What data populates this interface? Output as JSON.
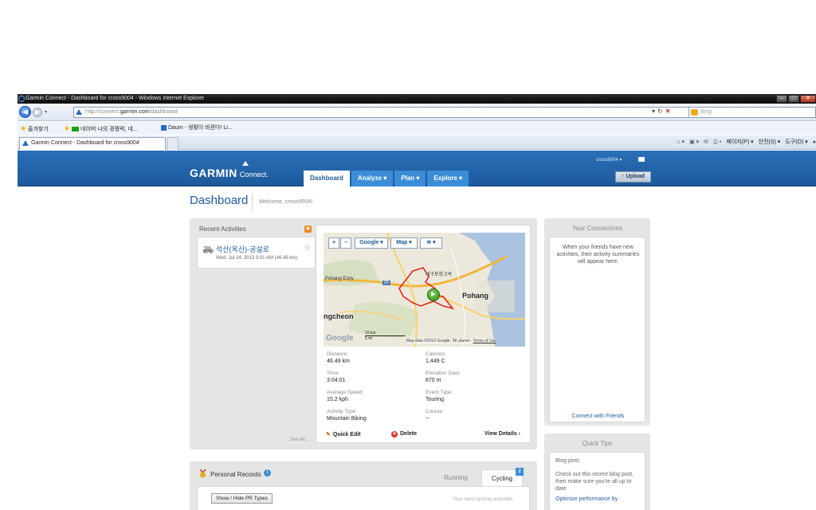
{
  "browser": {
    "title": "Garmin Connect - Dashboard for cross9004 - Windows Internet Explorer",
    "url_prefix": "http://connect.",
    "url_domain": "garmin.com",
    "url_path": "/dashboard",
    "search_placeholder": "Bing",
    "favorites": [
      "즐겨찾기",
      "네이버 나의 경쟁력, 네...",
      "Daum - 생활이 바뀐다! Li..."
    ],
    "tab_title": "Garmin Connect - Dashboard for cross9004",
    "commands": [
      "페이지(P) ▾",
      "안전(S) ▾",
      "도구(O) ▾"
    ]
  },
  "header": {
    "logo": "GARMIN",
    "logo_sub": "Connect.",
    "nav": [
      "Dashboard",
      "Analyze ▾",
      "Plan ▾",
      "Explore ▾"
    ],
    "user": "cross9004 ▾",
    "upload": "↑ Upload"
  },
  "page": {
    "title": "Dashboard",
    "welcome": "Welcome, cross9004!"
  },
  "recent": {
    "heading": "Recent Activities",
    "activity_name": "석산(옥산)-공설로",
    "activity_date": "Wed, Jul 24, 2013 9:01 AM (46.49 km)",
    "see_all": "See All...",
    "map": {
      "zoom_in": "+",
      "zoom_out": "−",
      "provider": "Google ▾",
      "type": "Map ▾",
      "layers": "≋ ▾",
      "labels": [
        "Pohang",
        "ngcheon",
        "-Pohang Expy",
        "대구포항고속"
      ],
      "shield": "20",
      "scale_km": "10 km",
      "scale_mi": "5 mi",
      "attribution_pre": "Map data ©2013 Google, SK planet -",
      "attribution_link": "Terms of Use",
      "watermark": "Google"
    },
    "stats": [
      {
        "label": "Distance:",
        "value": "46.49 km"
      },
      {
        "label": "Calories:",
        "value": "1,449 C"
      },
      {
        "label": "Time:",
        "value": "3:04:01"
      },
      {
        "label": "Elevation Gain:",
        "value": "870 m"
      },
      {
        "label": "Average Speed",
        "value": "15.2 kph"
      },
      {
        "label": "Event Type:",
        "value": "Touring"
      },
      {
        "label": "Activity Type:",
        "value": "Mountain Biking"
      },
      {
        "label": "Course:",
        "value": "--"
      }
    ],
    "actions": {
      "edit": "Quick Edit",
      "delete": "Delete",
      "details": "View Details ›"
    }
  },
  "connections": {
    "heading": "Your Connections",
    "message": "When your friends have new activities, their activity summaries will appear here.",
    "link": "Connect with Friends"
  },
  "tips": {
    "heading": "Quick Tips",
    "line1": "Blog post:",
    "line2": "Check out this recent blog post, then make sure you're all up to date",
    "link": "Optimize performance by"
  },
  "records": {
    "heading": "Personal Records",
    "tabs": [
      "Running",
      "Cycling"
    ],
    "badge": "2",
    "button": "Show / Hide PR Types",
    "note": "Your best cycling activities"
  }
}
